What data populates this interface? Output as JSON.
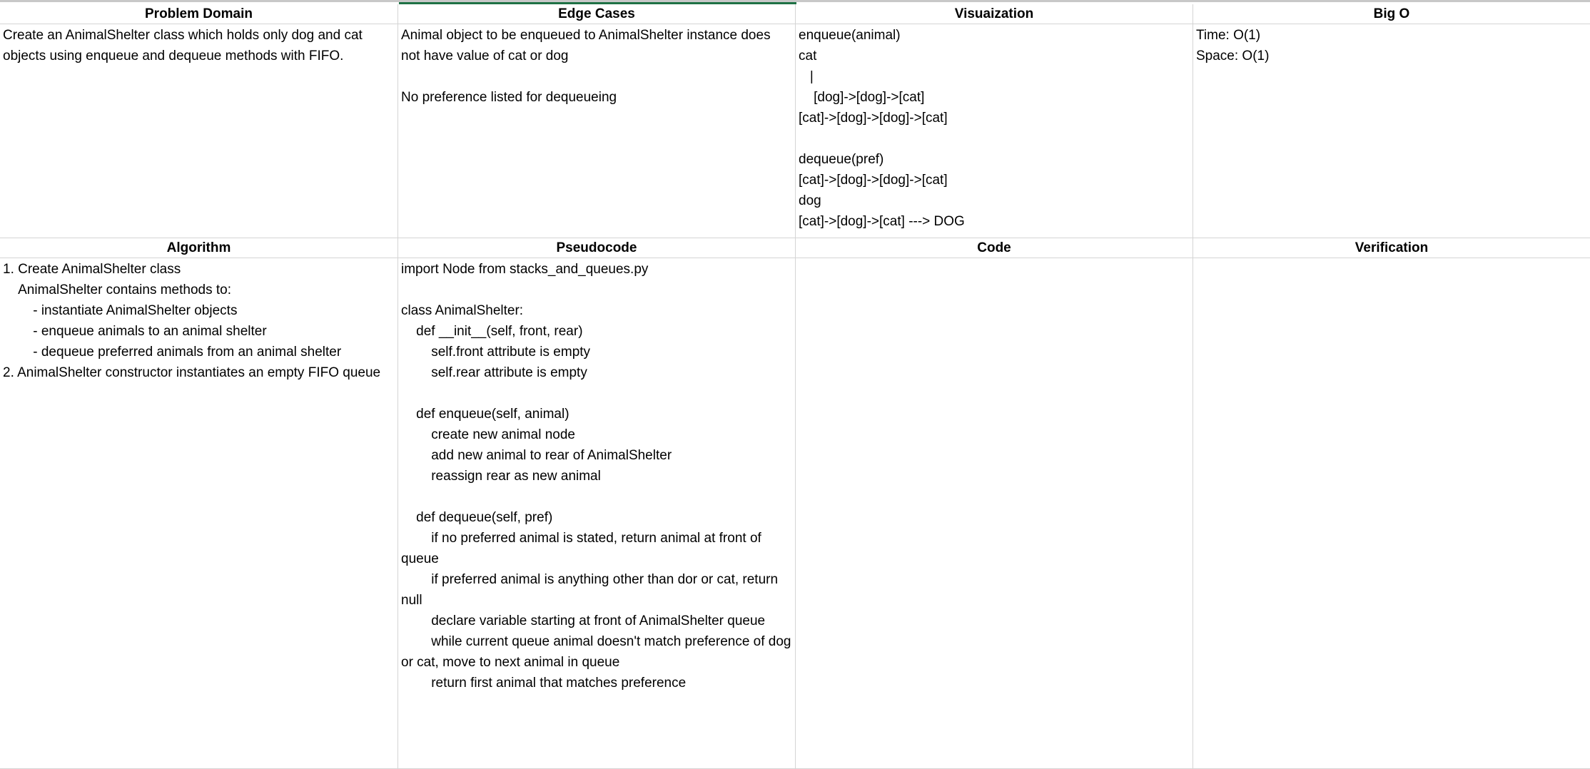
{
  "headers_top": [
    "Problem Domain",
    "Edge Cases",
    "Visuaization",
    "Big O"
  ],
  "headers_bottom": [
    "Algorithm",
    "Pseudocode",
    "Code",
    "Verification"
  ],
  "cells": {
    "problem_domain": "Create an AnimalShelter class which holds only dog and cat objects using enqueue and dequeue methods with FIFO.",
    "edge_cases": "Animal object to be enqueued to AnimalShelter instance does not have value of cat or dog\n\nNo preference listed for dequeueing",
    "visualization": "enqueue(animal)\ncat\n   |\n    [dog]->[dog]->[cat]\n[cat]->[dog]->[dog]->[cat]\n\ndequeue(pref)\n[cat]->[dog]->[dog]->[cat]\ndog\n[cat]->[dog]->[cat] ---> DOG",
    "big_o": "Time: O(1)\nSpace: O(1)",
    "algorithm": "1. Create AnimalShelter class\n    AnimalShelter contains methods to:\n        - instantiate AnimalShelter objects\n        - enqueue animals to an animal shelter\n        - dequeue preferred animals from an animal shelter\n2. AnimalShelter constructor instantiates an empty FIFO queue",
    "pseudocode": "import Node from stacks_and_queues.py\n\nclass AnimalShelter:\n    def __init__(self, front, rear)\n        self.front attribute is empty\n        self.rear attribute is empty\n\n    def enqueue(self, animal)\n        create new animal node\n        add new animal to rear of AnimalShelter\n        reassign rear as new animal\n\n    def dequeue(self, pref)\n        if no preferred animal is stated, return animal at front of queue\n        if preferred animal is anything other than dor or cat, return null\n        declare variable starting at front of AnimalShelter queue\n        while current queue animal doesn't match preference of dog or cat, move to next animal in queue\n        return first animal that matches preference",
    "code": "",
    "verification": ""
  },
  "colors": {
    "gridline": "#d4d4d4",
    "selected_column_edge": "#1e7145"
  }
}
